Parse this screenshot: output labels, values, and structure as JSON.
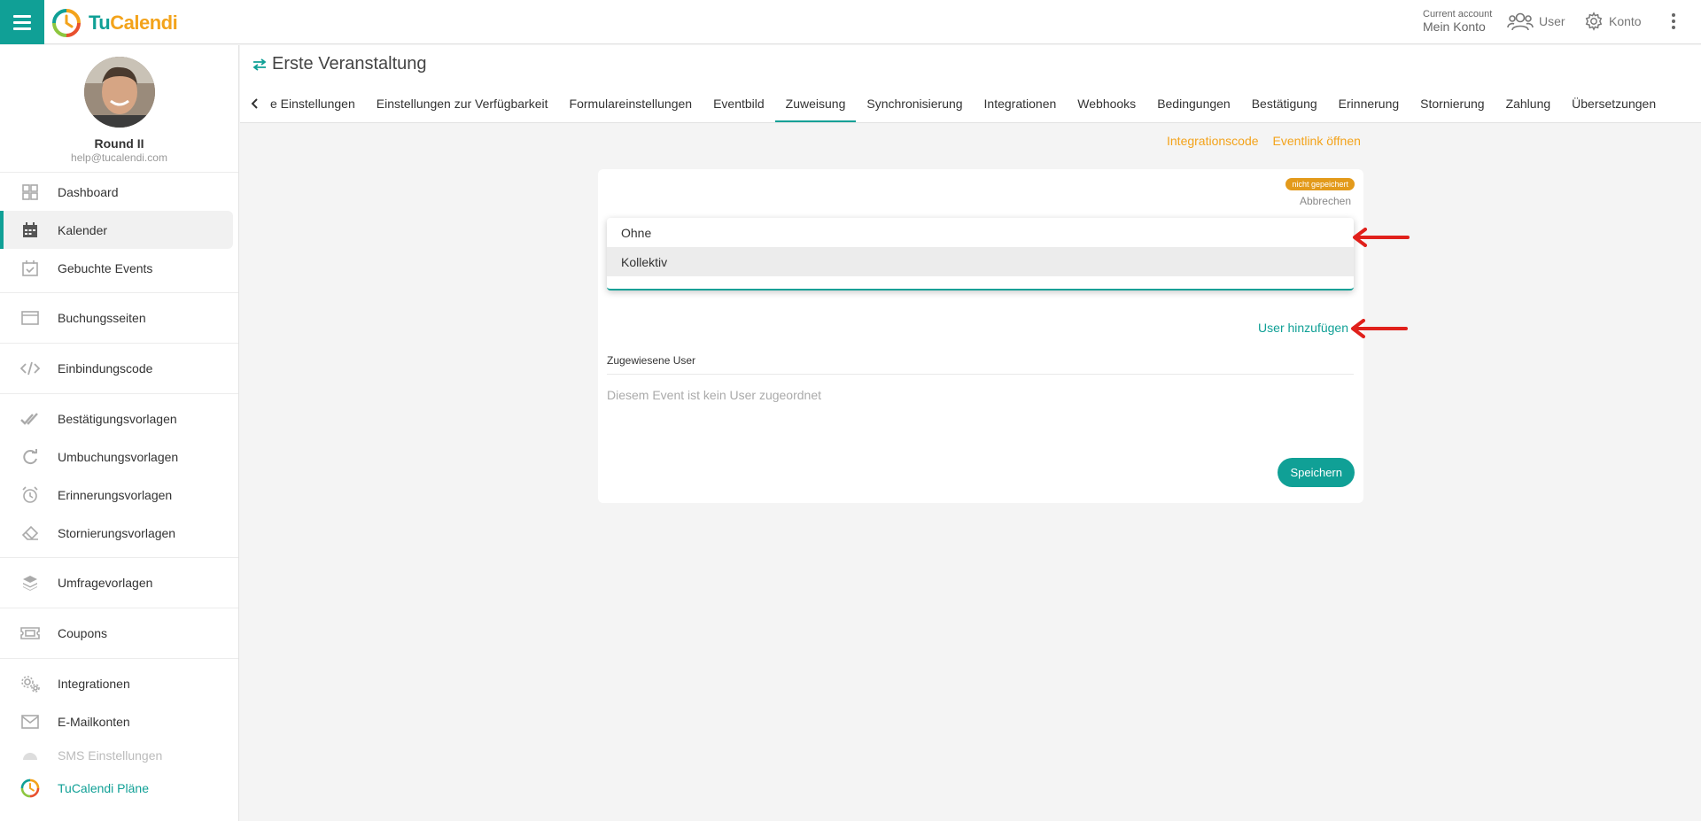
{
  "app": {
    "logo_part1": "Tu",
    "logo_part2": "Calendi",
    "account_caption": "Current account",
    "account_name": "Mein Konto",
    "user_label": "User",
    "konto_label": "Konto"
  },
  "profile": {
    "name": "Round II",
    "email": "help@tucalendi.com"
  },
  "sidebar": {
    "items": [
      {
        "label": "Dashboard",
        "icon": "grid-icon"
      },
      {
        "label": "Kalender",
        "icon": "calendar-icon"
      },
      {
        "label": "Gebuchte Events",
        "icon": "calendar-check-icon"
      },
      {
        "label": "Buchungsseiten",
        "icon": "browser-window-icon"
      },
      {
        "label": "Einbindungscode",
        "icon": "code-icon"
      },
      {
        "label": "Bestätigungsvorlagen",
        "icon": "double-check-icon"
      },
      {
        "label": "Umbuchungsvorlagen",
        "icon": "redo-icon"
      },
      {
        "label": "Erinnerungsvorlagen",
        "icon": "alarm-clock-icon"
      },
      {
        "label": "Stornierungsvorlagen",
        "icon": "eraser-icon"
      },
      {
        "label": "Umfragevorlagen",
        "icon": "layers-icon"
      },
      {
        "label": "Coupons",
        "icon": "ticket-icon"
      },
      {
        "label": "Integrationen",
        "icon": "gears-icon"
      },
      {
        "label": "E-Mailkonten",
        "icon": "mail-icon"
      },
      {
        "label": "SMS Einstellungen",
        "icon": "sms-icon"
      },
      {
        "label": "TuCalendi Pläne",
        "icon": "tucalendi-logo-icon"
      }
    ]
  },
  "page": {
    "title": "Erste Veranstaltung",
    "tabs": [
      "e Einstellungen",
      "Einstellungen zur Verfügbarkeit",
      "Formulareinstellungen",
      "Eventbild",
      "Zuweisung",
      "Synchronisierung",
      "Integrationen",
      "Webhooks",
      "Bedingungen",
      "Bestätigung",
      "Erinnerung",
      "Stornierung",
      "Zahlung",
      "Übersetzungen"
    ],
    "active_tab": "Zuweisung",
    "link_integration": "Integrationscode",
    "link_event": "Eventlink öffnen"
  },
  "card": {
    "badge": "nicht gepeichert",
    "cancel": "Abbrechen",
    "options": [
      "Ohne",
      "Kollektiv"
    ],
    "highlighted_option": "Kollektiv",
    "add_user": "User hinzufügen",
    "assigned_label": "Zugewiesene User",
    "empty_text": "Diesem Event ist kein User zugeordnet",
    "save": "Speichern"
  },
  "colors": {
    "accent": "#10a096",
    "brand_orange": "#f3a31b",
    "annotation_arrow": "#e0201b"
  }
}
